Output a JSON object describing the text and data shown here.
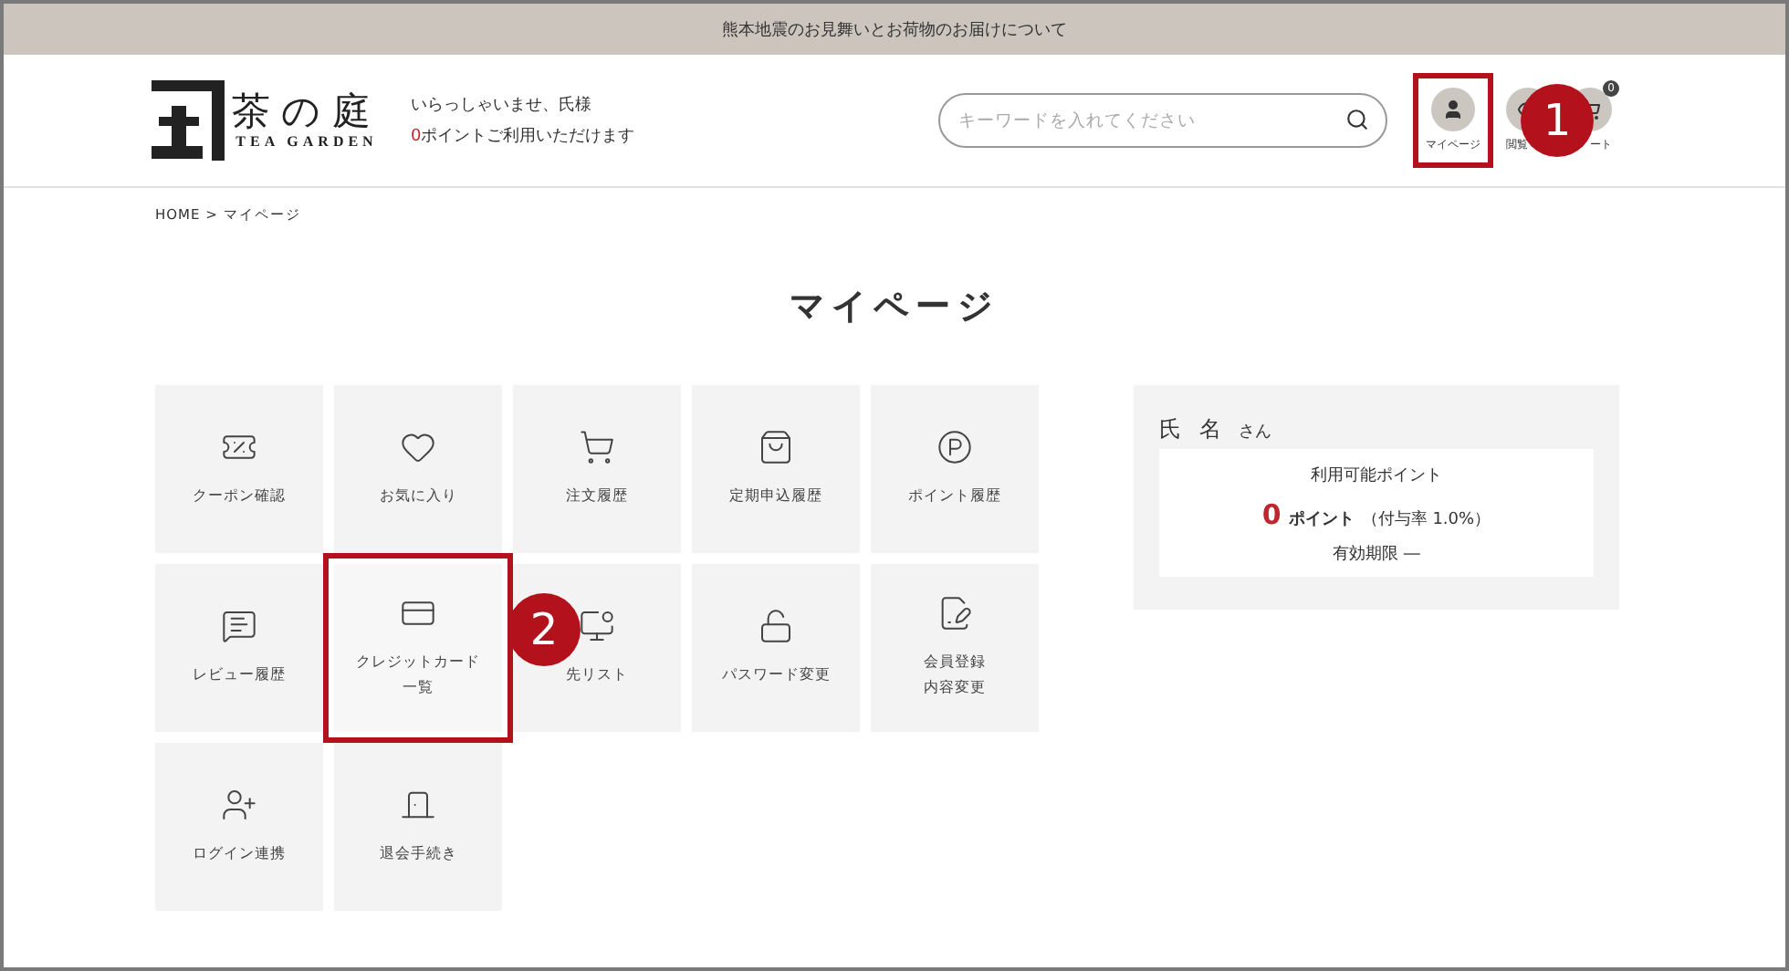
{
  "notice_bar": {
    "text": "熊本地震のお見舞いとお荷物のお届けについて"
  },
  "header": {
    "logo": {
      "name": "茶の庭",
      "subtitle": "TEA GARDEN"
    },
    "greeting": "いらっしゃいませ、氏様",
    "points_line": {
      "count": "0",
      "text": "ポイントご利用いただけます"
    },
    "search": {
      "placeholder": "キーワードを入れてください"
    },
    "nav": [
      {
        "label": "マイページ",
        "highlighted": true,
        "callout": "1"
      },
      {
        "label": "閲覧",
        "highlighted": false
      },
      {
        "label": "ート",
        "highlighted": false,
        "badge": "0"
      }
    ]
  },
  "breadcrumb": "HOME > マイページ",
  "page_title": "マイページ",
  "tiles": [
    {
      "lines": [
        "クーポン確認"
      ],
      "highlighted": false
    },
    {
      "lines": [
        "お気に入り"
      ],
      "highlighted": false
    },
    {
      "lines": [
        "注文履歴"
      ],
      "highlighted": false
    },
    {
      "lines": [
        "定期申込履歴"
      ],
      "highlighted": false
    },
    {
      "lines": [
        "ポイント履歴"
      ],
      "highlighted": false
    },
    {
      "lines": [
        "レビュー履歴"
      ],
      "highlighted": false
    },
    {
      "lines": [
        "クレジットカード",
        "一覧"
      ],
      "highlighted": true,
      "callout": "2"
    },
    {
      "lines": [
        "先リスト"
      ],
      "highlighted": false
    },
    {
      "lines": [
        "パスワード変更"
      ],
      "highlighted": false
    },
    {
      "lines": [
        "会員登録",
        "内容変更"
      ],
      "highlighted": false
    },
    {
      "lines": [
        "ログイン連携"
      ],
      "highlighted": false
    },
    {
      "lines": [
        "退会手続き"
      ],
      "highlighted": false
    }
  ],
  "member_card": {
    "name": "氏 名",
    "suffix": "さん",
    "points_label": "利用可能ポイント",
    "points_value": "0",
    "points_unit": "ポイント",
    "rate": "（付与率 1.0%）",
    "expiry": "有効期限 ―"
  }
}
